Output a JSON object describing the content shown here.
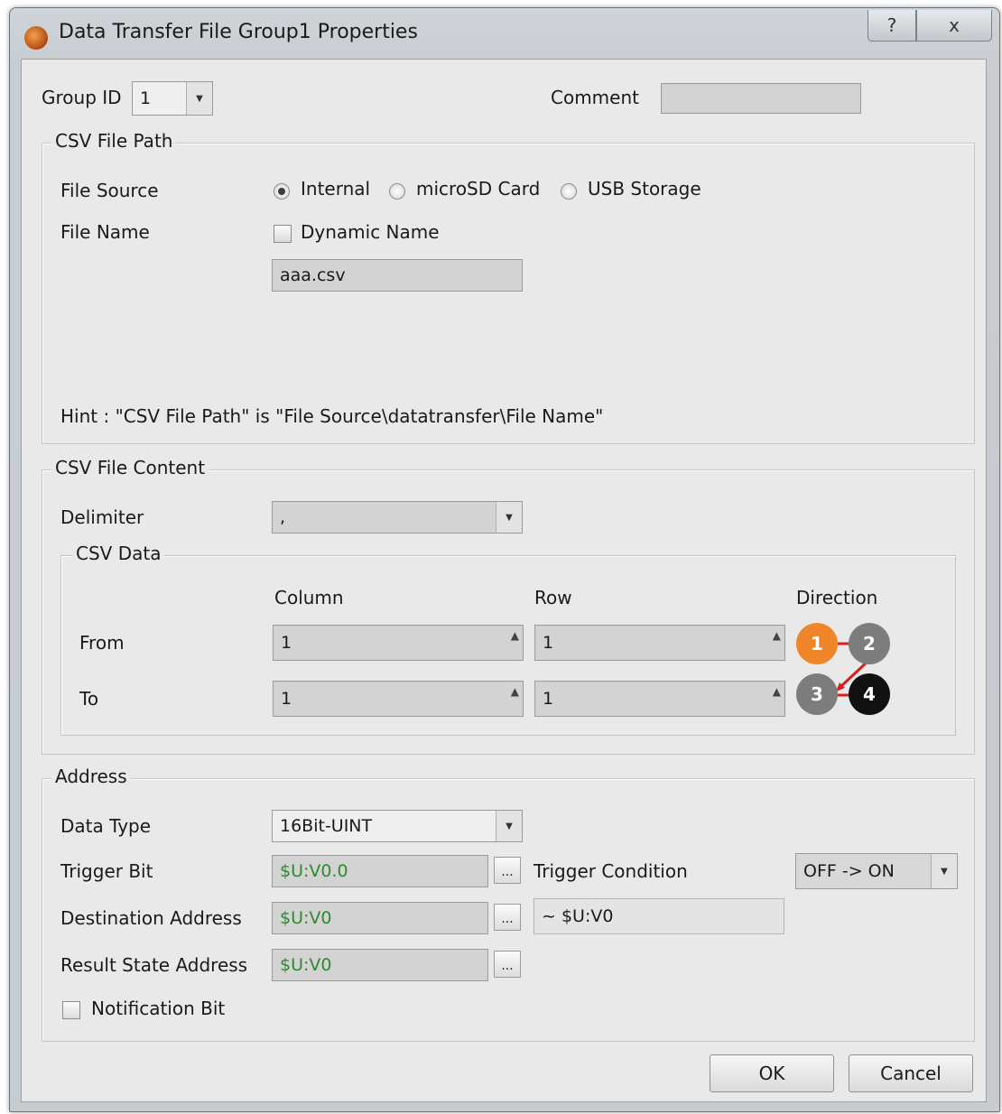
{
  "window": {
    "title": "Data Transfer File Group1 Properties",
    "help_label": "?",
    "close_label": "x"
  },
  "top": {
    "group_id_label": "Group ID",
    "group_id_value": "1",
    "comment_label": "Comment",
    "comment_value": ""
  },
  "csv_path": {
    "title": "CSV File Path",
    "file_source_label": "File Source",
    "sources": [
      {
        "label": "Internal",
        "selected": true
      },
      {
        "label": "microSD Card",
        "selected": false
      },
      {
        "label": "USB Storage",
        "selected": false
      }
    ],
    "file_name_label": "File Name",
    "dynamic_name_label": "Dynamic Name",
    "file_name_value": "aaa.csv",
    "hint": "Hint : \"CSV File Path\" is \"File Source\\datatransfer\\File Name\""
  },
  "csv_content": {
    "title": "CSV File Content",
    "delimiter_label": "Delimiter",
    "delimiter_value": ",",
    "csv_data": {
      "title": "CSV Data",
      "column_header": "Column",
      "row_header": "Row",
      "direction_header": "Direction",
      "from_label": "From",
      "to_label": "To",
      "from_column": "1",
      "from_row": "1",
      "to_column": "1",
      "to_row": "1",
      "direction_steps": [
        "1",
        "2",
        "3",
        "4"
      ]
    }
  },
  "address": {
    "title": "Address",
    "data_type_label": "Data Type",
    "data_type_value": "16Bit-UINT",
    "trigger_bit_label": "Trigger Bit",
    "trigger_bit_value": "$U:V0.0",
    "trigger_condition_label": "Trigger Condition",
    "trigger_condition_value": "OFF -> ON",
    "destination_label": "Destination Address",
    "destination_value": "$U:V0",
    "destination_range": "~ $U:V0",
    "result_state_label": "Result State Address",
    "result_state_value": "$U:V0",
    "notification_label": "Notification Bit",
    "browse_label": "..."
  },
  "buttons": {
    "ok": "OK",
    "cancel": "Cancel"
  },
  "colors": {
    "direction_active": "#f0862a",
    "direction_idle": "#7d7d7d",
    "direction_end": "#111111",
    "arrow": "#d62020"
  }
}
